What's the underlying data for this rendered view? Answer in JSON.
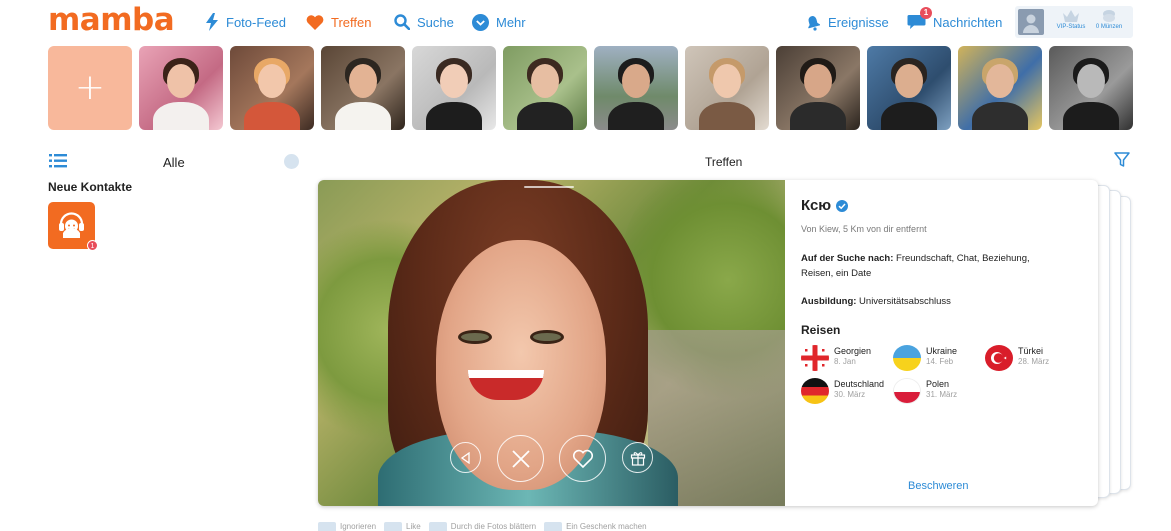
{
  "header": {
    "logo": "mamba",
    "nav": [
      {
        "label": "Foto-Feed",
        "icon": "lightning-icon"
      },
      {
        "label": "Treffen",
        "icon": "heart-icon",
        "active": true
      },
      {
        "label": "Suche",
        "icon": "search-icon"
      },
      {
        "label": "Mehr",
        "icon": "chevron-down-icon"
      }
    ],
    "events_label": "Ereignisse",
    "messages_label": "Nachrichten",
    "messages_count": "1",
    "vip_label": "VIP-Status",
    "coins_label": "0 Münzen"
  },
  "colors": {
    "brand": "#f26b21",
    "link": "#2d8bd6",
    "badge": "#e84d5b"
  },
  "sidebar": {
    "filter_label": "Alle",
    "section_title": "Neue Kontakte",
    "contact_badge": "1"
  },
  "main": {
    "title": "Treffen",
    "profile": {
      "name": "Ксю",
      "distance": "Von Kiew, 5 Km von dir entfernt",
      "looking_for_label": "Auf der Suche nach:",
      "looking_for_value": "Freundschaft, Chat, Beziehung, Reisen, ein Date",
      "education_label": "Ausbildung:",
      "education_value": "Universitätsabschluss",
      "travel_title": "Reisen",
      "trips": [
        {
          "country": "Georgien",
          "date": "8. Jan"
        },
        {
          "country": "Ukraine",
          "date": "14. Feb"
        },
        {
          "country": "Türkei",
          "date": "28. März"
        },
        {
          "country": "Deutschland",
          "date": "30. März"
        },
        {
          "country": "Polen",
          "date": "31. März"
        }
      ],
      "report_label": "Beschweren"
    },
    "hints": [
      "Ignorieren",
      "Like",
      "Durch die Fotos blättern",
      "Ein Geschenk machen"
    ]
  }
}
